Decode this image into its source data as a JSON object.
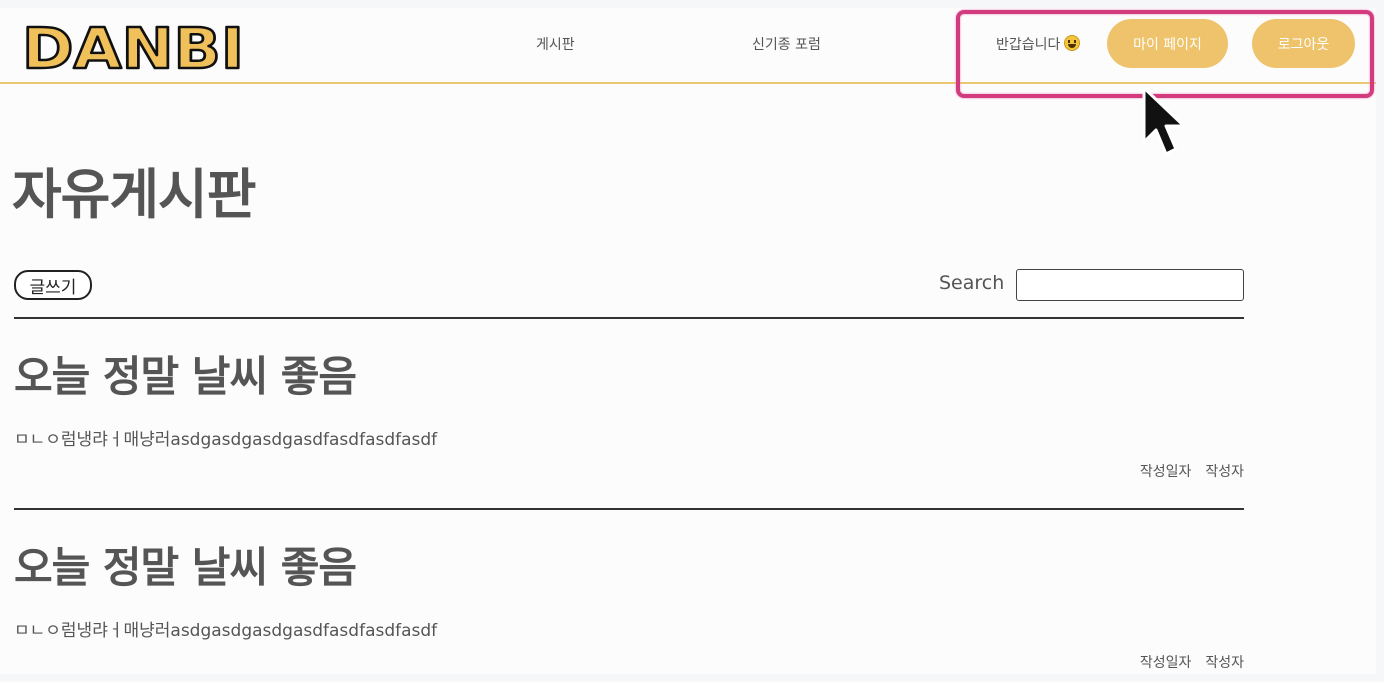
{
  "header": {
    "logo_text": "DANBI",
    "nav": [
      {
        "label": "게시판"
      },
      {
        "label": "신기종 포럼"
      }
    ],
    "greeting": "반갑습니다",
    "greeting_icon": "smiley-face-icon",
    "mypage_label": "마이 페이지",
    "logout_label": "로그아웃"
  },
  "main": {
    "page_title": "자유게시판",
    "write_label": "글쓰기",
    "search_label": "Search",
    "search_value": ""
  },
  "posts": [
    {
      "title": "오늘 정말 날씨 좋음",
      "body": "ㅁㄴㅇ럼냉랴ㅓ매냥러asdgasdgasdgasdfasdfasdfasdf",
      "date_label": "작성일자",
      "author_label": "작성자"
    },
    {
      "title": "오늘 정말 날씨 좋음",
      "body": "ㅁㄴㅇ럼냉랴ㅓ매냥러asdgasdgasdgasdfasdfasdfasdf",
      "date_label": "작성일자",
      "author_label": "작성자"
    }
  ],
  "colors": {
    "accent": "#eec36b",
    "logo_fill": "#f0c05a",
    "highlight": "#d23c7f",
    "header_rule": "#e9c873"
  }
}
